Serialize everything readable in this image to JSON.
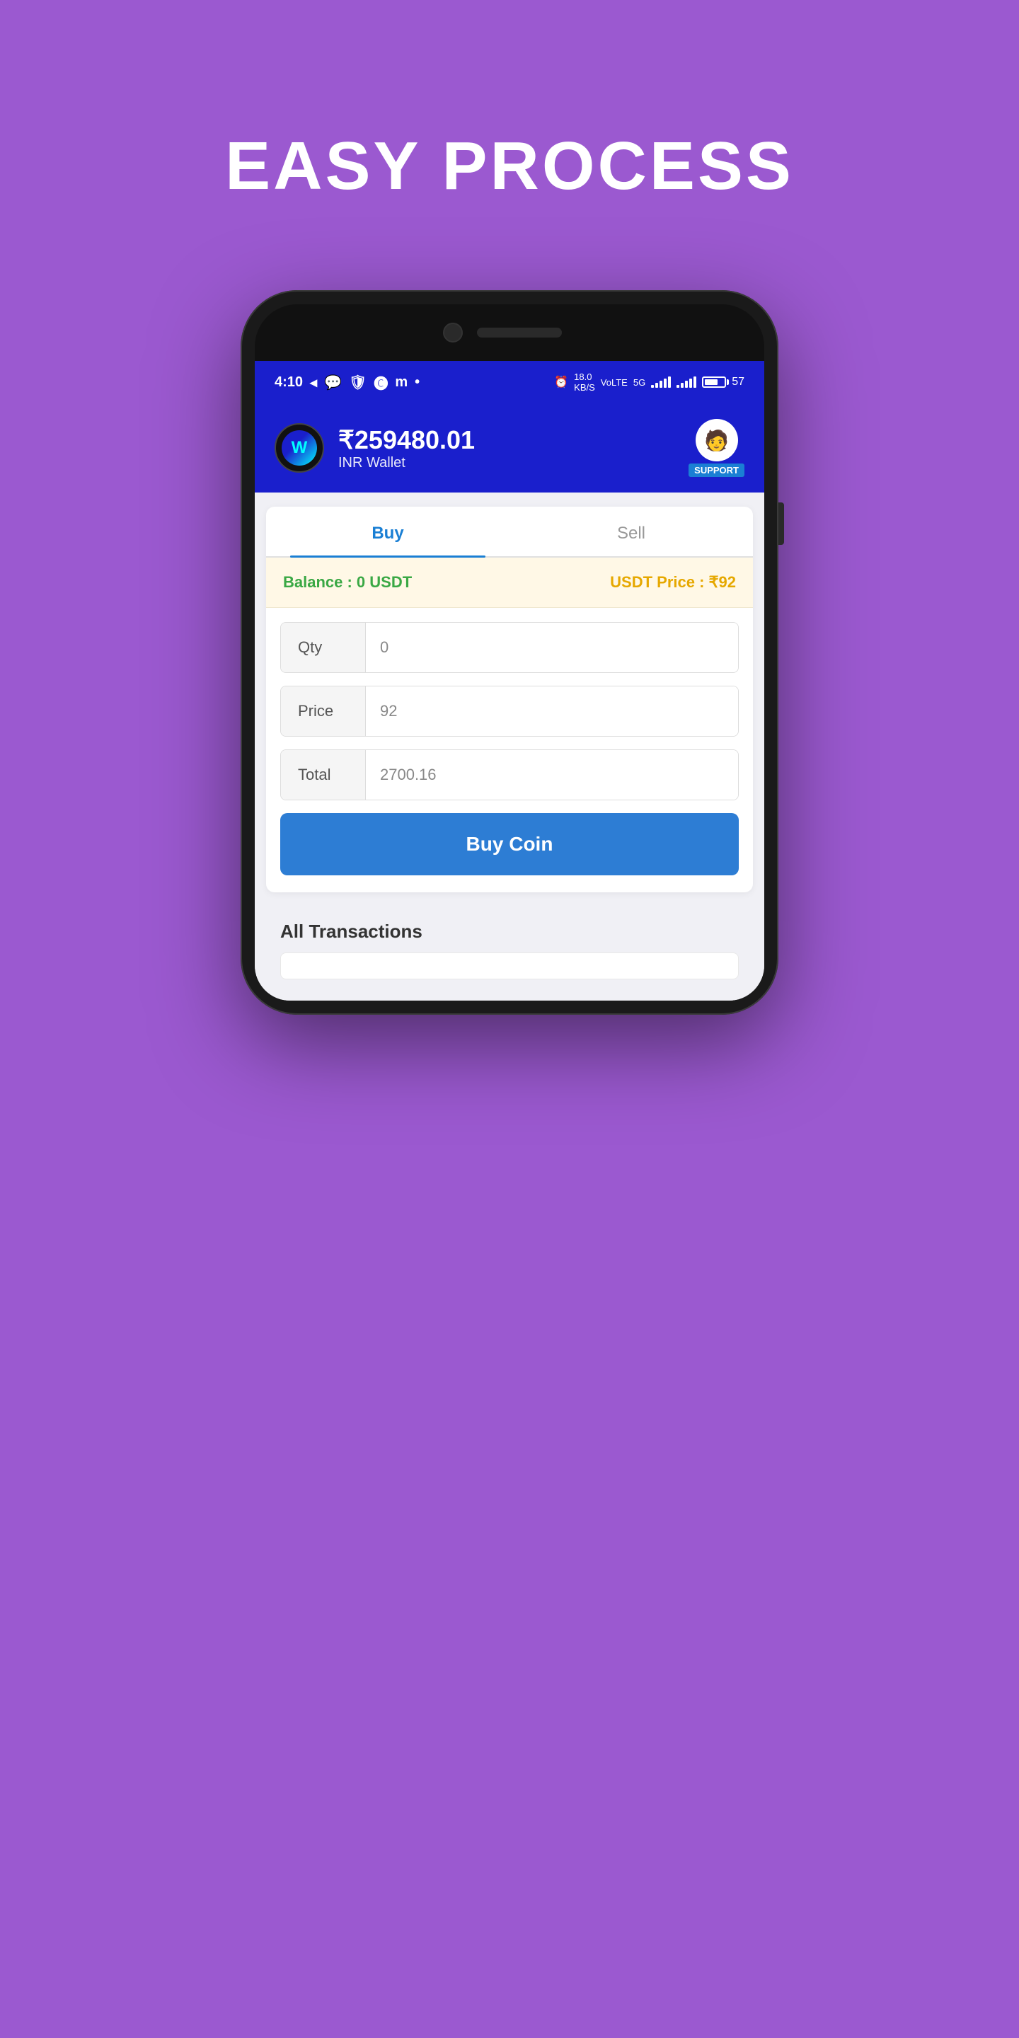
{
  "page": {
    "background_color": "#9b59d0",
    "hero_title": "EASY PROCESS"
  },
  "status_bar": {
    "time": "4:10",
    "battery_percent": "57"
  },
  "app_header": {
    "amount": "₹259480.01",
    "wallet_label": "INR Wallet",
    "support_label": "SUPPORT"
  },
  "tabs": [
    {
      "id": "buy",
      "label": "Buy",
      "active": true
    },
    {
      "id": "sell",
      "label": "Sell",
      "active": false
    }
  ],
  "balance_bar": {
    "balance_label": "Balance : 0 USDT",
    "price_label": "USDT Price : ₹92"
  },
  "form": {
    "qty_label": "Qty",
    "qty_value": "0",
    "price_label": "Price",
    "price_value": "92",
    "total_label": "Total",
    "total_value": "2700.16",
    "buy_button_label": "Buy Coin"
  },
  "transactions": {
    "title": "All Transactions"
  }
}
